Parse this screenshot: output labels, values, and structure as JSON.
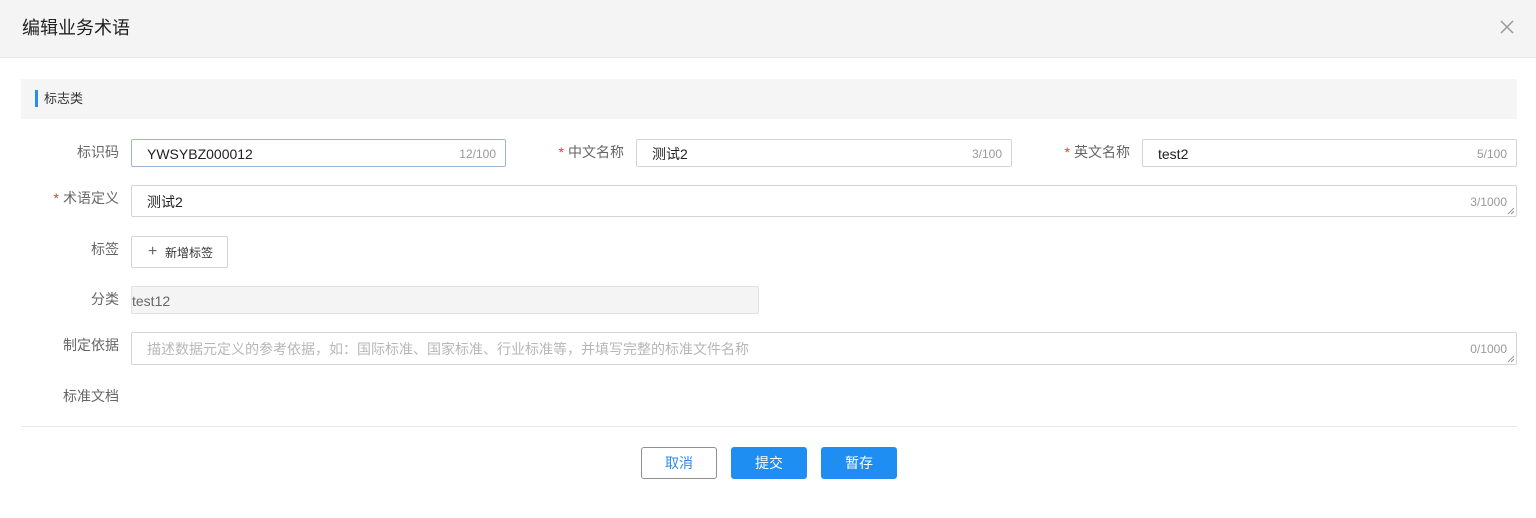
{
  "dialog": {
    "title": "编辑业务术语"
  },
  "section": {
    "label": "标志类"
  },
  "fields": {
    "code": {
      "label": "标识码",
      "value": "YWSYBZ000012",
      "count": "12/100"
    },
    "cn_name": {
      "required": "*",
      "label": "中文名称",
      "value": "测试2",
      "count": "3/100"
    },
    "en_name": {
      "required": "*",
      "label": "英文名称",
      "value": "test2",
      "count": "5/100"
    },
    "definition": {
      "required": "*",
      "label": "术语定义",
      "value": "测试2",
      "count": "3/1000"
    },
    "tags": {
      "label": "标签",
      "add_label": "新增标签"
    },
    "category": {
      "label": "分类",
      "value": "test12"
    },
    "basis": {
      "label": "制定依据",
      "placeholder": "描述数据元定义的参考依据，如：国际标准、国家标准、行业标准等，并填写完整的标准文件名称",
      "count": "0/1000"
    },
    "documents": {
      "label": "标准文档"
    }
  },
  "footer": {
    "cancel_label": "取消",
    "submit_label": "提交",
    "save_label": "暂存"
  },
  "colors": {
    "accent": "#1e8ef3",
    "required": "#ee3333"
  }
}
